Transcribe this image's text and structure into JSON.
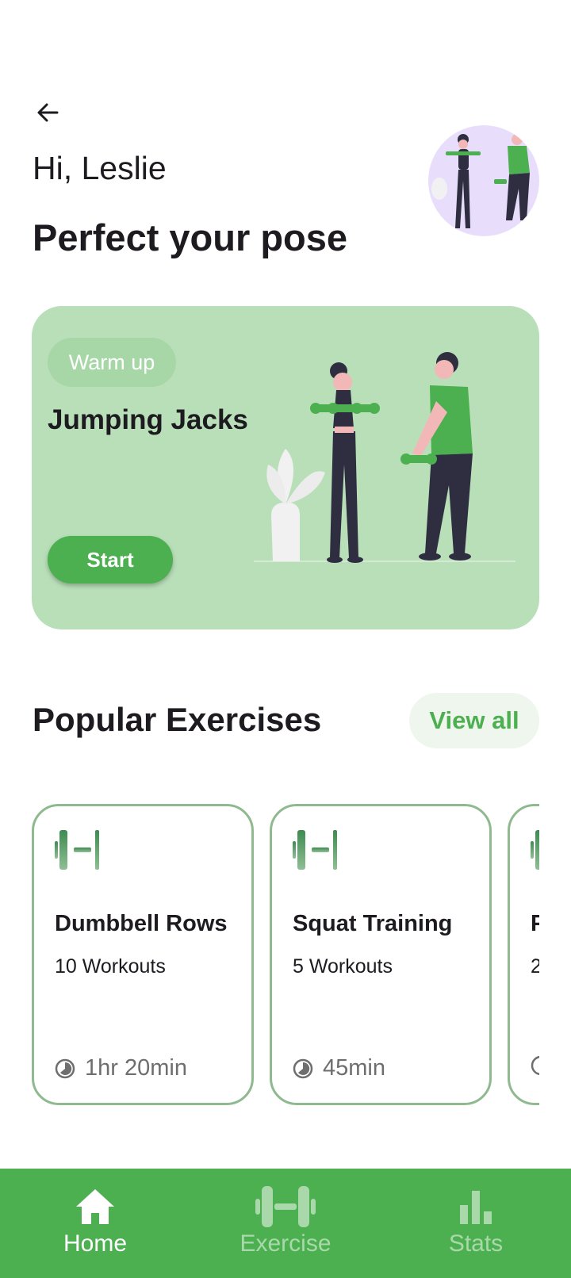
{
  "header": {
    "greeting": "Hi, Leslie",
    "title": "Perfect your pose"
  },
  "hero": {
    "chip": "Warm up",
    "title": "Jumping Jacks",
    "start_label": "Start",
    "background": "#b9dfb9"
  },
  "popular": {
    "title": "Popular Exercises",
    "view_all_label": "View all",
    "cards": [
      {
        "name": "Dumbbell Rows",
        "count": "10 Workouts",
        "duration": "1hr 20min"
      },
      {
        "name": "Squat Training",
        "count": "5 Workouts",
        "duration": "45min"
      },
      {
        "name": "P",
        "count": "2",
        "duration": ""
      }
    ]
  },
  "nav": {
    "items": [
      {
        "label": "Home",
        "icon": "home-icon",
        "active": true
      },
      {
        "label": "Exercise",
        "icon": "dumbbell-icon",
        "active": false
      },
      {
        "label": "Stats",
        "icon": "bar-chart-icon",
        "active": false
      }
    ]
  },
  "colors": {
    "accent": "#4caf50",
    "card_border": "#8fb98f",
    "avatar_bg": "#e8defc"
  }
}
